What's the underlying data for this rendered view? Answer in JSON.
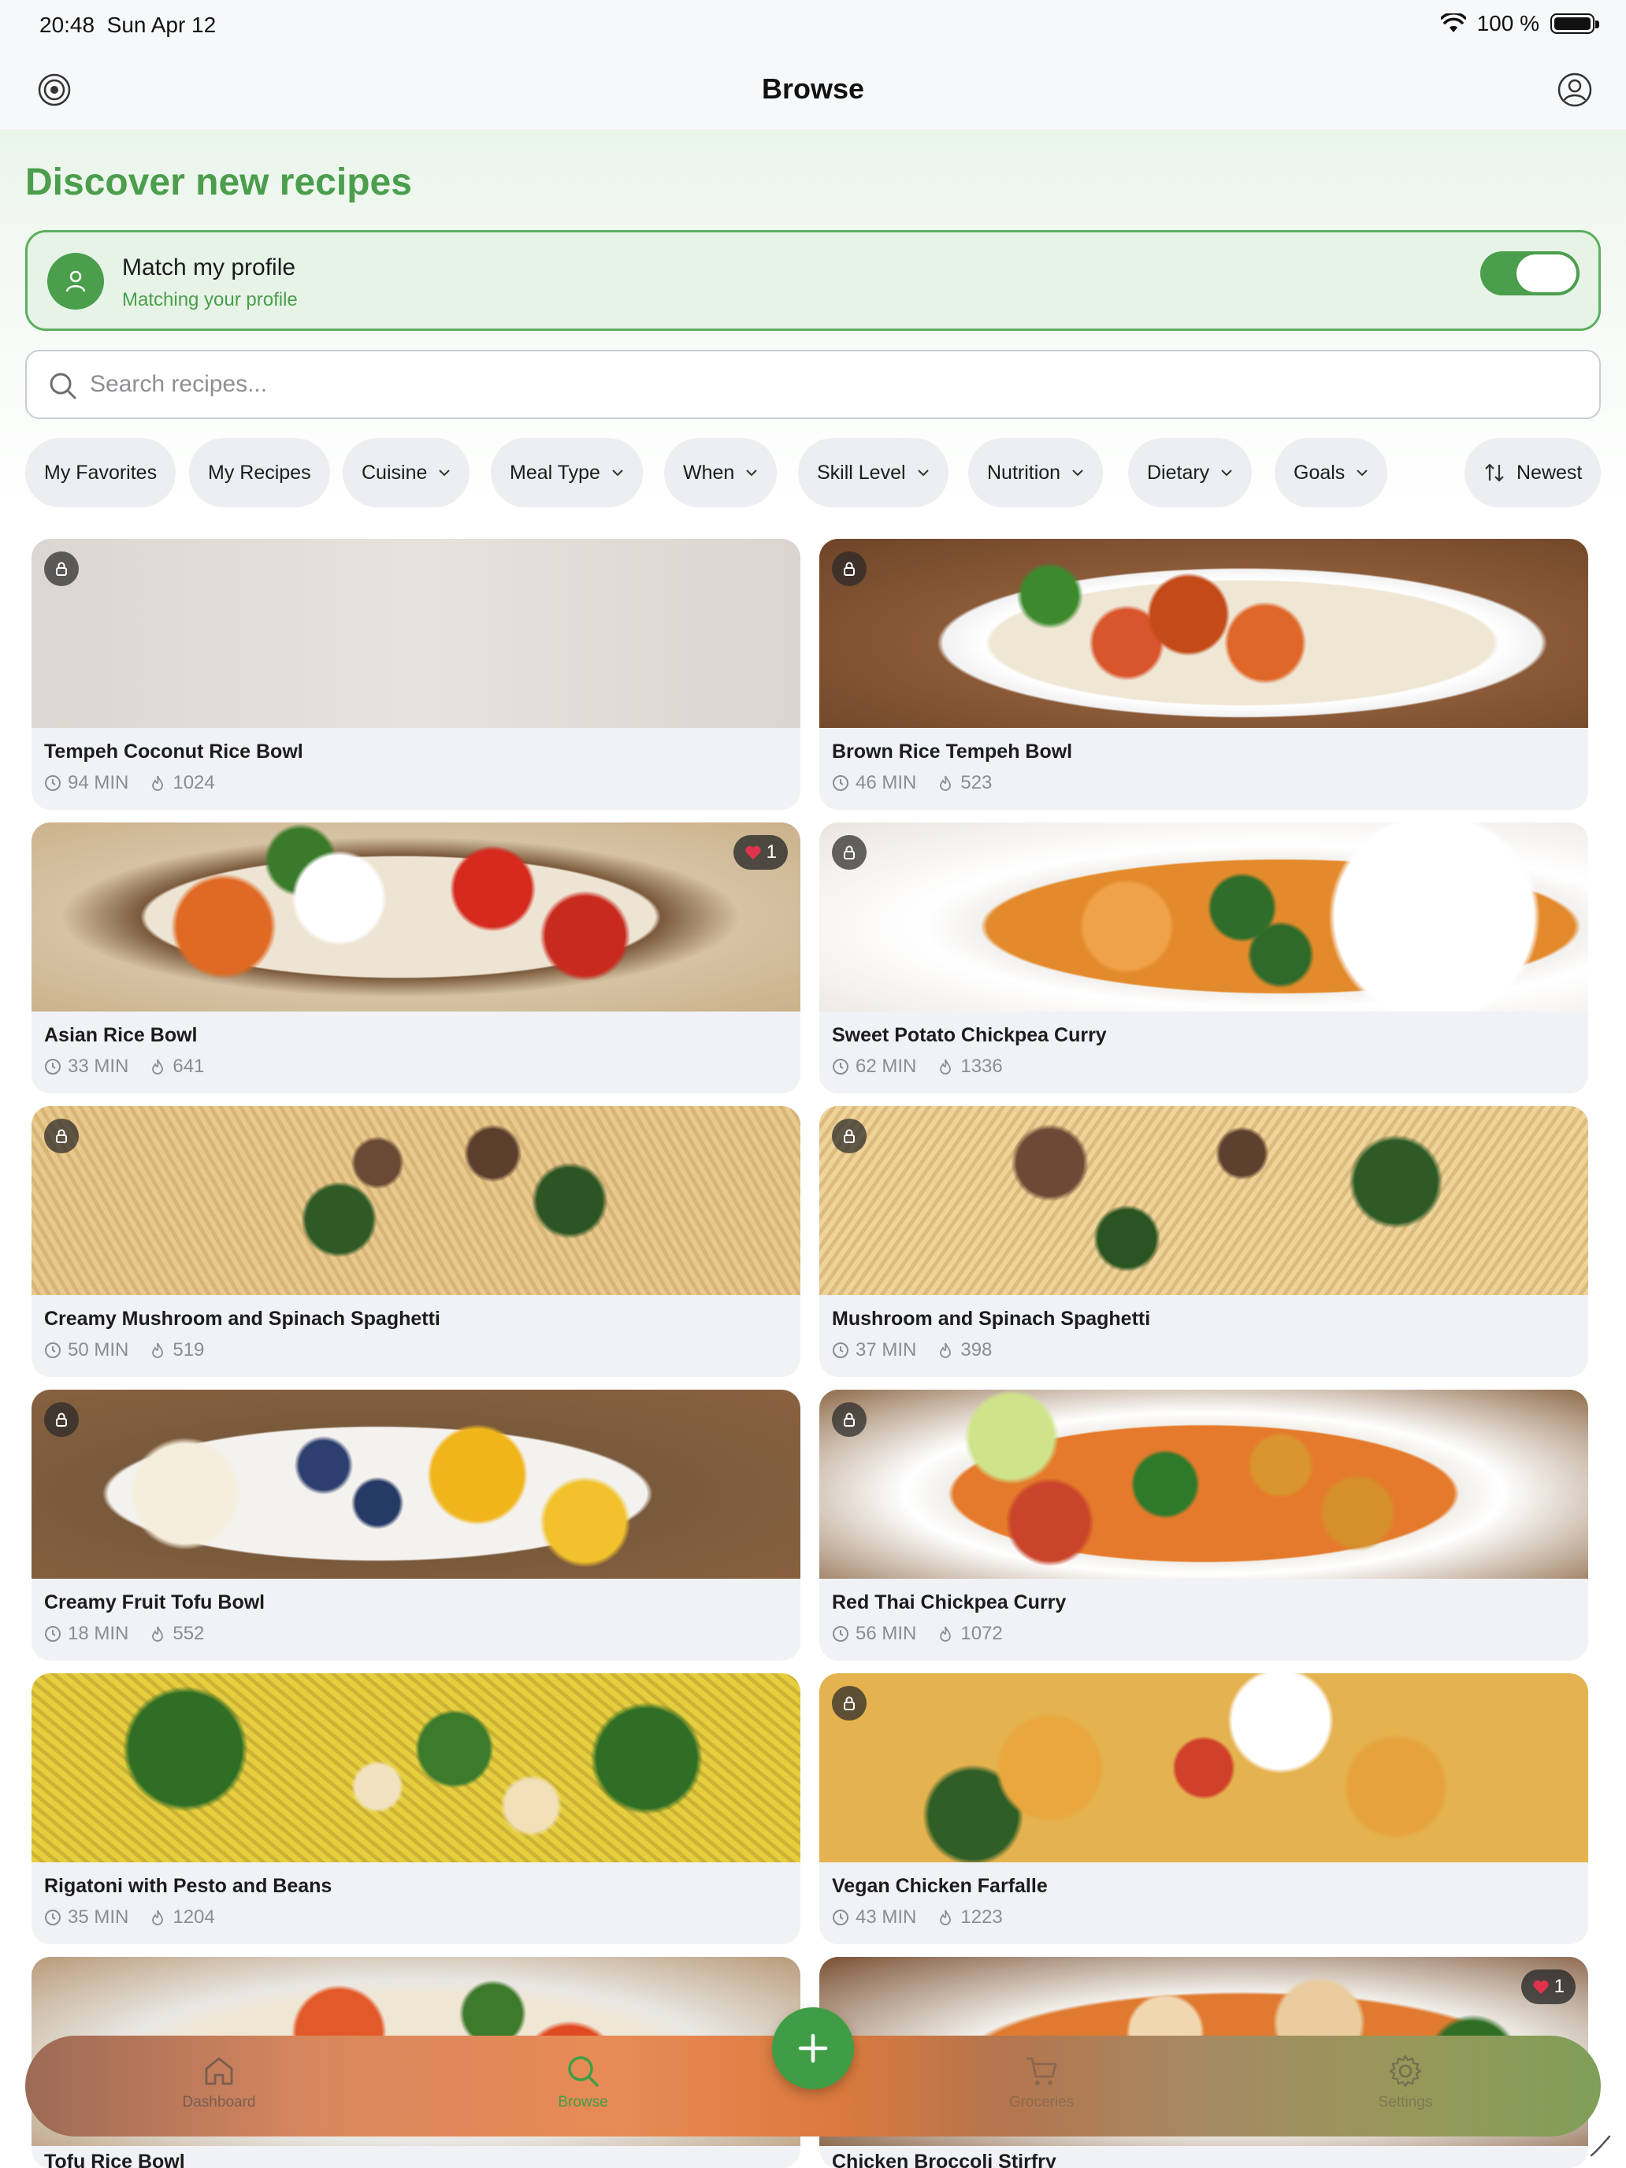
{
  "status_bar": {
    "time": "20:48",
    "date": "Sun Apr 12",
    "battery": "100 %"
  },
  "nav": {
    "title": "Browse",
    "left_icon": "target-icon",
    "right_icon": "account-icon"
  },
  "main": {
    "heading": "Discover new recipes"
  },
  "profile": {
    "title": "Match my profile",
    "subtitle": "Matching your profile",
    "toggle_on": true
  },
  "search": {
    "placeholder": "Search recipes...",
    "value": ""
  },
  "filters": [
    {
      "label": "My Favorites",
      "dropdown": false
    },
    {
      "label": "My Recipes",
      "dropdown": false
    },
    {
      "label": "Cuisine",
      "dropdown": true
    },
    {
      "label": "Meal Type",
      "dropdown": true
    },
    {
      "label": "When",
      "dropdown": true
    },
    {
      "label": "Skill Level",
      "dropdown": true
    },
    {
      "label": "Nutrition",
      "dropdown": true
    },
    {
      "label": "Dietary",
      "dropdown": true
    },
    {
      "label": "Goals",
      "dropdown": true
    }
  ],
  "sort": {
    "label": "Newest"
  },
  "recipes": [
    {
      "title": "Tempeh Coconut Rice Bowl",
      "time": "94 MIN",
      "calories": "1024",
      "locked": true,
      "favorites": null
    },
    {
      "title": "Brown Rice Tempeh Bowl",
      "time": "46 MIN",
      "calories": "523",
      "locked": true,
      "favorites": null
    },
    {
      "title": "Asian Rice Bowl",
      "time": "33 MIN",
      "calories": "641",
      "locked": false,
      "favorites": "1"
    },
    {
      "title": "Sweet Potato Chickpea Curry",
      "time": "62 MIN",
      "calories": "1336",
      "locked": true,
      "favorites": null
    },
    {
      "title": "Creamy Mushroom and Spinach Spaghetti",
      "time": "50 MIN",
      "calories": "519",
      "locked": true,
      "favorites": null
    },
    {
      "title": "Mushroom and Spinach Spaghetti",
      "time": "37 MIN",
      "calories": "398",
      "locked": true,
      "favorites": null
    },
    {
      "title": "Creamy Fruit Tofu Bowl",
      "time": "18 MIN",
      "calories": "552",
      "locked": true,
      "favorites": null
    },
    {
      "title": "Red Thai Chickpea Curry",
      "time": "56 MIN",
      "calories": "1072",
      "locked": true,
      "favorites": null
    },
    {
      "title": "Rigatoni with Pesto and Beans",
      "time": "35 MIN",
      "calories": "1204",
      "locked": false,
      "favorites": null
    },
    {
      "title": "Vegan Chicken Farfalle",
      "time": "43 MIN",
      "calories": "1223",
      "locked": true,
      "favorites": null
    },
    {
      "title": "Tofu Rice Bowl",
      "locked": false,
      "favorites": null
    },
    {
      "title": "Chicken Broccoli Stirfry",
      "locked": false,
      "favorites": "1"
    }
  ],
  "tabs": [
    {
      "label": "Dashboard",
      "icon": "home-icon",
      "active": false
    },
    {
      "label": "Browse",
      "icon": "search-icon",
      "active": true
    },
    {
      "label": "Groceries",
      "icon": "cart-icon",
      "active": false
    },
    {
      "label": "Settings",
      "icon": "gear-icon",
      "active": false
    }
  ],
  "fab": {
    "icon": "plus-icon"
  },
  "colors": {
    "accent": "#4a9e4c",
    "card_bg": "#f1f2f5",
    "chip_bg": "#eceef2"
  }
}
